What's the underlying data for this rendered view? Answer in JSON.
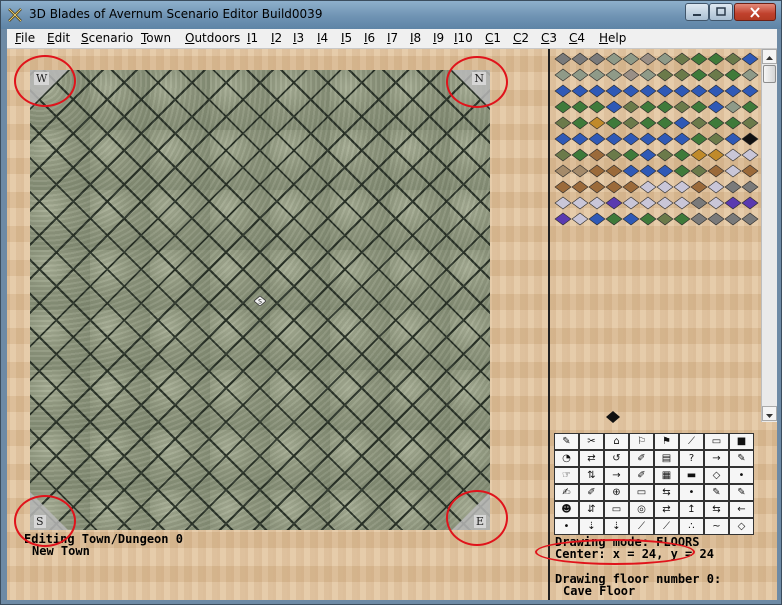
{
  "window": {
    "title": "3D Blades of Avernum Scenario Editor Build0039"
  },
  "menu": [
    {
      "label": "File",
      "accel": "F",
      "rest": "ile"
    },
    {
      "label": "Edit",
      "accel": "E",
      "rest": "dit"
    },
    {
      "label": "Scenario",
      "accel": "S",
      "rest": "cenario"
    },
    {
      "label": "Town",
      "accel": "T",
      "rest": "own"
    },
    {
      "label": "Outdoors",
      "accel": "O",
      "rest": "utdoors"
    },
    {
      "label": "I1",
      "accel": "I",
      "rest": "1"
    },
    {
      "label": "I2",
      "accel": "I",
      "rest": "2"
    },
    {
      "label": "I3",
      "accel": "I",
      "rest": "3"
    },
    {
      "label": "I4",
      "accel": "I",
      "rest": "4"
    },
    {
      "label": "I5",
      "accel": "I",
      "rest": "5"
    },
    {
      "label": "I6",
      "accel": "I",
      "rest": "6"
    },
    {
      "label": "I7",
      "accel": "I",
      "rest": "7"
    },
    {
      "label": "I8",
      "accel": "I",
      "rest": "8"
    },
    {
      "label": "I9",
      "accel": "I",
      "rest": "9"
    },
    {
      "label": "I10",
      "accel": "I",
      "rest": "10"
    },
    {
      "label": "C1",
      "accel": "C",
      "rest": "1"
    },
    {
      "label": "C2",
      "accel": "C",
      "rest": "2"
    },
    {
      "label": "C3",
      "accel": "C",
      "rest": "3"
    },
    {
      "label": "C4",
      "accel": "C",
      "rest": "4"
    },
    {
      "label": "Help",
      "accel": "H",
      "rest": "elp"
    }
  ],
  "map": {
    "corners": {
      "top_left": "W",
      "top_right": "N",
      "bottom_left": "S",
      "bottom_right": "E"
    },
    "center_marker": "S"
  },
  "status": {
    "editing_line": "Editing Town/Dungeon 0",
    "town_name": "New Town",
    "drawing_mode": "Drawing mode: FLOORS",
    "center": "Center: x = 24, y = 24",
    "floor_number": "Drawing floor number 0:",
    "floor_name": "Cave Floor"
  },
  "colors": {
    "annotation_circle": "#e0131b",
    "tile_palette": [
      "#8f9a88",
      "#9a8f86",
      "#2f59b6",
      "#3f7a3a",
      "#6b7a4a",
      "#c08a2a",
      "#9b6a3a",
      "#7a7a7a",
      "#5a3ab0",
      "#c9c6d8",
      "#111111",
      "#a48a6a"
    ]
  }
}
